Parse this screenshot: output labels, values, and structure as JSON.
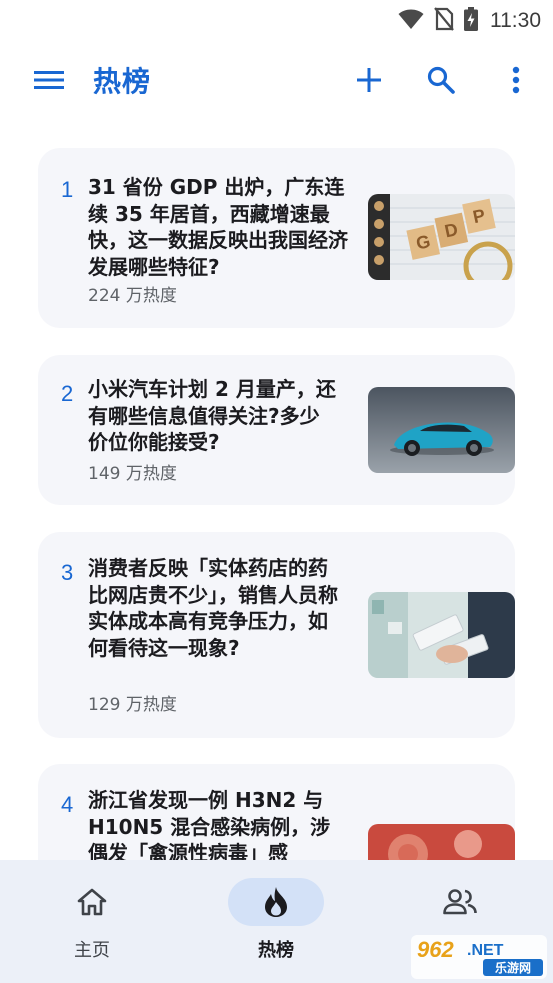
{
  "status_bar": {
    "time": "11:30",
    "icons": [
      "wifi-icon",
      "no-sim-icon",
      "battery-charging-icon"
    ]
  },
  "app_bar": {
    "title": "热榜",
    "menu_icon": "menu-icon",
    "actions": [
      "add-icon",
      "search-icon",
      "more-vert-icon"
    ]
  },
  "colors": {
    "accent": "#1967d2",
    "card_bg": "#f5f6fa",
    "nav_bg": "#ecf0f8",
    "nav_active_pill": "#d3e1f7"
  },
  "feed": {
    "items": [
      {
        "rank": "1",
        "title": "31 省份 GDP 出炉，广东连续 35 年居首，西藏增速最快，这一数据反映出我国经济发展哪些特征?",
        "heat": "224 万热度",
        "image": "GDP 木块与放大镜"
      },
      {
        "rank": "2",
        "title": "小米汽车计划 2 月量产，还有哪些信息值得关注?多少价位你能接受?",
        "heat": "149 万热度",
        "image": "蓝色轿车"
      },
      {
        "rank": "3",
        "title": "消费者反映「实体药店的药比网店贵不少」，销售人员称实体成本高有竞争压力，如何看待这一现象?",
        "heat": "129 万热度",
        "image": "药店中手持药盒"
      },
      {
        "rank": "4",
        "title": "浙江省发现一例 H3N2 与 H10N5 混合感染病例，涉偶发「禽源性病毒」感",
        "heat": "",
        "image": "病毒图像"
      }
    ]
  },
  "bottom_nav": {
    "items": [
      {
        "label": "主页",
        "icon": "home-icon"
      },
      {
        "label": "热榜",
        "icon": "fire-icon"
      },
      {
        "label": "",
        "icon": "people-icon"
      }
    ]
  },
  "watermark": {
    "text_top": "962.NET",
    "text_bottom": "乐游网"
  }
}
